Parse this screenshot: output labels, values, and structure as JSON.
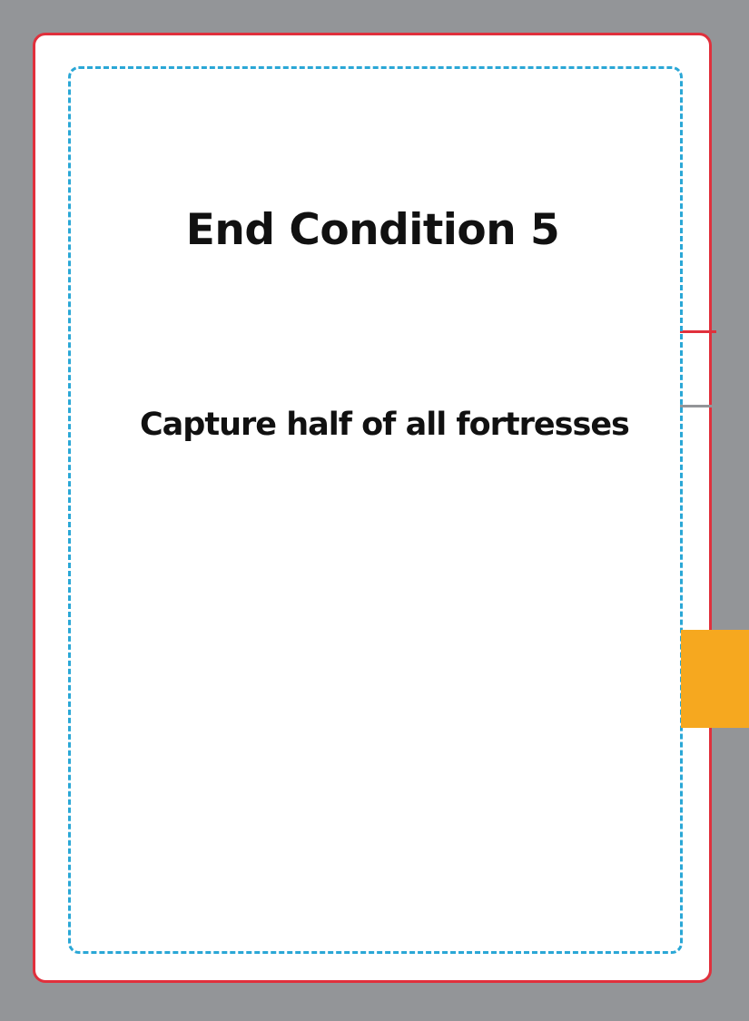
{
  "card": {
    "title": "End Condition 5",
    "description": "Capture half of all fortresses"
  },
  "colors": {
    "background": "#939598",
    "card_border": "#e0303c",
    "safe_zone_border": "#2aa7d6",
    "tab": "#f6a81f",
    "text": "#111111"
  }
}
